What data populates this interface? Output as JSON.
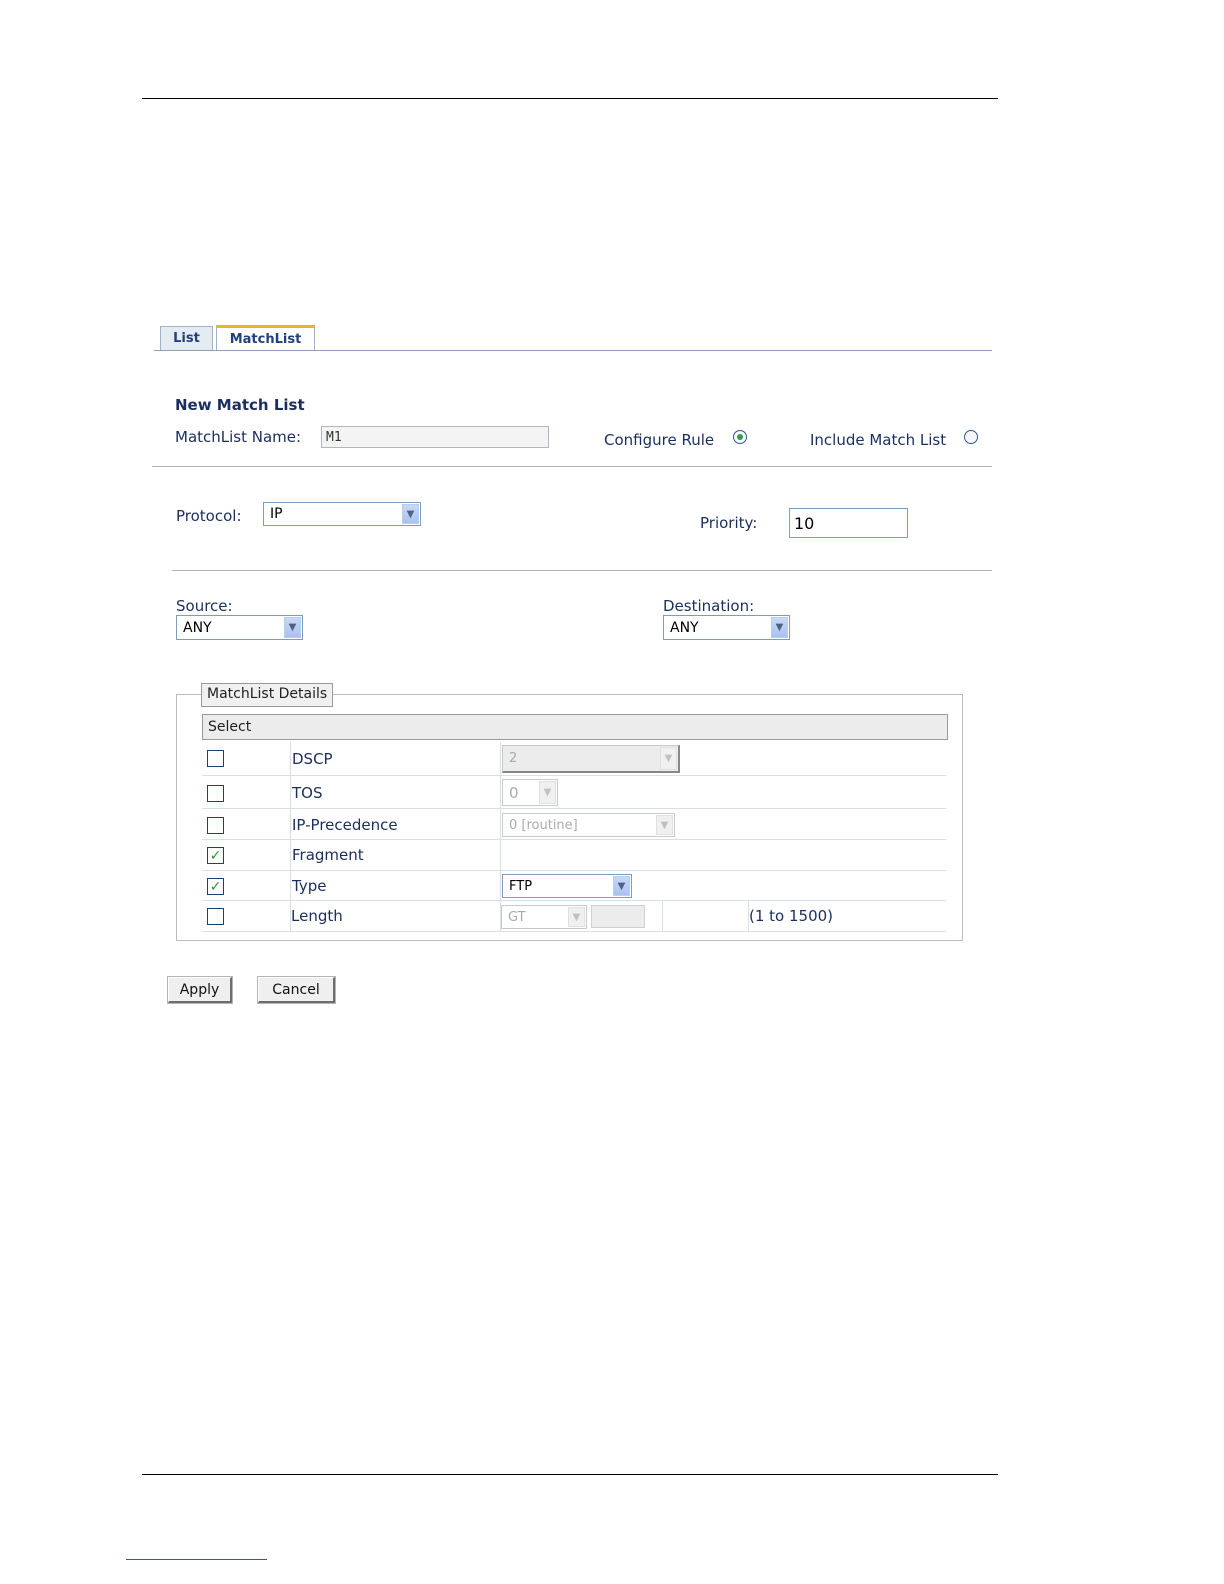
{
  "tabs": [
    {
      "label": "List",
      "active": false
    },
    {
      "label": "MatchList",
      "active": true
    }
  ],
  "form": {
    "section_title": "New Match List",
    "name_label": "MatchList Name:",
    "name_value": "M1",
    "configure_rule_label": "Configure Rule",
    "configure_rule_selected": true,
    "include_match_list_label": "Include Match List",
    "include_match_list_selected": false,
    "protocol_label": "Protocol:",
    "protocol_value": "IP",
    "priority_label": "Priority:",
    "priority_value": "10",
    "source_label": "Source:",
    "source_value": "ANY",
    "destination_label": "Destination:",
    "destination_value": "ANY"
  },
  "details": {
    "legend": "MatchList Details",
    "header": "Select",
    "rows": [
      {
        "label": "DSCP",
        "checked": false,
        "value": "2"
      },
      {
        "label": "TOS",
        "checked": false,
        "value": "0"
      },
      {
        "label": "IP-Precedence",
        "checked": false,
        "value": "0 [routine]"
      },
      {
        "label": "Fragment",
        "checked": true
      },
      {
        "label": "Type",
        "checked": true,
        "value": "FTP"
      },
      {
        "label": "Length",
        "checked": false,
        "value": "GT",
        "range": "(1 to 1500)"
      }
    ]
  },
  "buttons": {
    "apply": "Apply",
    "cancel": "Cancel"
  },
  "colors": {
    "tab_active_accent": "#f0b030",
    "check_green": "#1a9c2f",
    "label_navy": "#1a2f5c"
  }
}
